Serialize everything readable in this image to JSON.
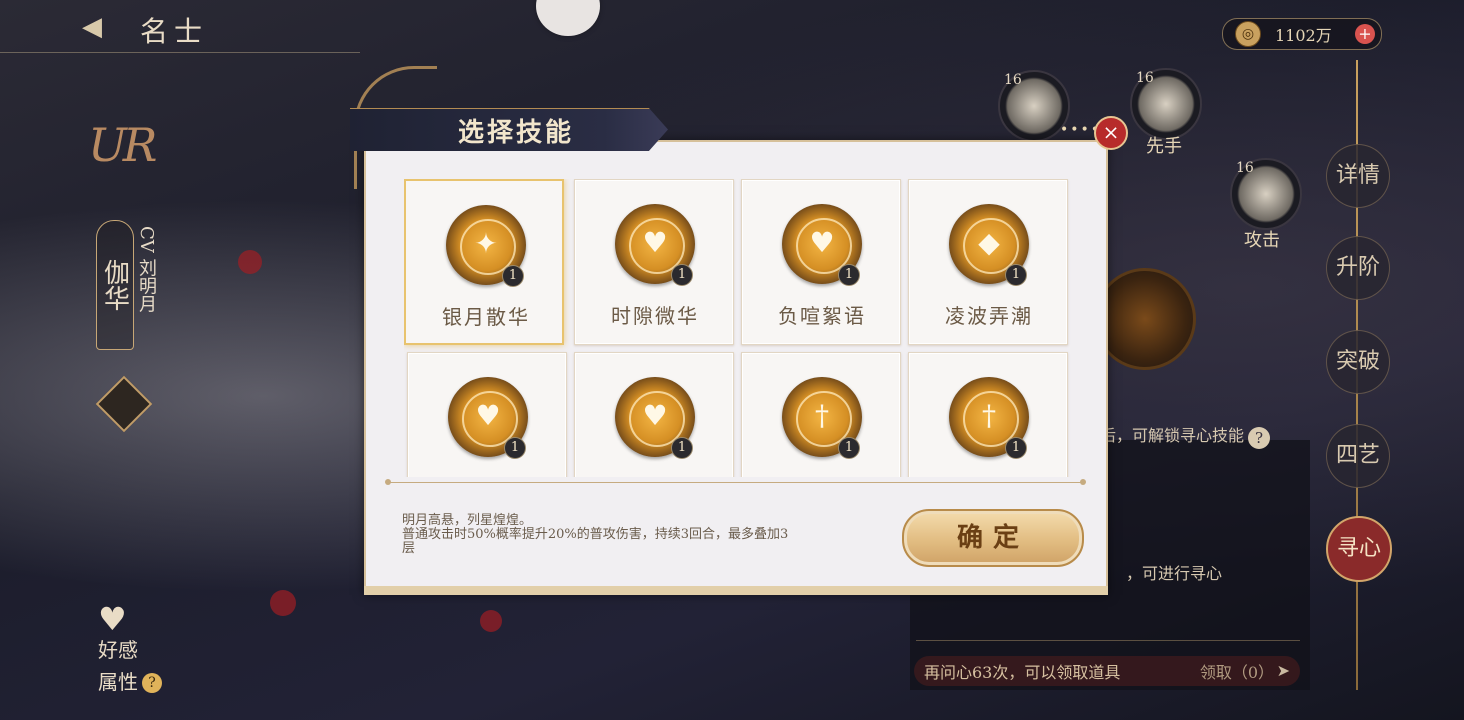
{
  "header": {
    "title": "名士",
    "back_symbol": "◀"
  },
  "character": {
    "rarity": "UR",
    "name": "伽华",
    "cv": "CV 刘明月"
  },
  "left_menu": {
    "favor": "好感",
    "attributes": "属性",
    "help": "?"
  },
  "currency": {
    "amount": "1102万",
    "icon": "copper-coin-icon",
    "plus": "+"
  },
  "right_tabs": [
    {
      "label": "详情"
    },
    {
      "label": "升阶"
    },
    {
      "label": "突破"
    },
    {
      "label": "四艺"
    },
    {
      "label": "寻心",
      "active": true
    }
  ],
  "stones": [
    {
      "level": "16",
      "label": ""
    },
    {
      "level": "16",
      "label": "先手"
    },
    {
      "level": "16",
      "label": "攻击"
    }
  ],
  "background_panel": {
    "unlock_hint": "后，可解锁寻心技能",
    "trace_text": "，可进行寻心",
    "reward_text": "再问心63次，可以领取道具",
    "reward_claim": "领取（0）"
  },
  "dialog": {
    "title": "选择技能",
    "close": "×",
    "skills": [
      {
        "name": "银月散华",
        "level": "1",
        "glyph": "✦",
        "icon": "flame-shield-icon",
        "selected": true
      },
      {
        "name": "时隙微华",
        "level": "1",
        "glyph": "♥",
        "icon": "heart-plus-icon"
      },
      {
        "name": "负喧絮语",
        "level": "1",
        "glyph": "♥",
        "icon": "flame-heart-icon"
      },
      {
        "name": "凌波弄潮",
        "level": "1",
        "glyph": "◆",
        "icon": "broken-heart-shield-icon"
      },
      {
        "name": "",
        "level": "1",
        "glyph": "♥",
        "icon": "heart-shield-icon"
      },
      {
        "name": "",
        "level": "1",
        "glyph": "♥",
        "icon": "flame-heart-plus-icon"
      },
      {
        "name": "",
        "level": "1",
        "glyph": "†",
        "icon": "sword-icon"
      },
      {
        "name": "",
        "level": "1",
        "glyph": "†",
        "icon": "sword-flame-icon"
      }
    ],
    "description_line1": "明月高悬，列星煌煌。",
    "description_line2": "普通攻击时50%概率提升20%的普攻伤害，持续3回合，最多叠加3层",
    "confirm_label": "确定"
  },
  "colors": {
    "accent_gold": "#e2bd82",
    "panel_bg": "#f1eff2",
    "active_tab": "#8a2a2a"
  }
}
